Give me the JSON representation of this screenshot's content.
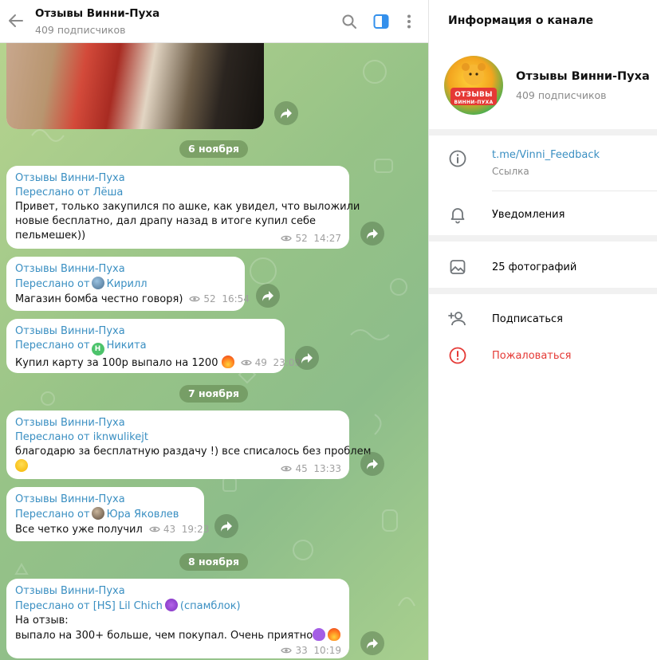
{
  "header": {
    "title": "Отзывы Винни-Пуха",
    "subscribers": "409 подписчиков"
  },
  "dates": [
    "6 ноября",
    "7 ноября",
    "8 ноября"
  ],
  "messages": [
    {
      "channel": "Отзывы Винни-Пуха",
      "fwd_prefix": "Переслано от",
      "fwd_name": "Лёша",
      "lines": [
        "Привет, только закупился по ашке, как увидел, что выложили",
        "новые бесплатно, дал драпу назад в итоге купил себе",
        "пельмешек))"
      ],
      "views": "52",
      "time": "14:27"
    },
    {
      "channel": "Отзывы Винни-Пуха",
      "fwd_prefix": "Переслано от",
      "fwd_name": "Кирилл",
      "lines": [
        "Магазин бомба честно говоря)"
      ],
      "views": "52",
      "time": "16:54"
    },
    {
      "channel": "Отзывы Винни-Пуха",
      "fwd_prefix": "Переслано от",
      "fwd_name": "Никита",
      "avatar_letter": "Н",
      "lines": [
        "Купил карту за 100р выпало на 1200"
      ],
      "views": "49",
      "time": "23:09"
    },
    {
      "channel": "Отзывы Винни-Пуха",
      "fwd_prefix": "Переслано от",
      "fwd_name": "iknwulikejt",
      "lines": [
        "благодарю за бесплатную раздачу !) все списалось без проблем"
      ],
      "views": "45",
      "time": "13:33"
    },
    {
      "channel": "Отзывы Винни-Пуха",
      "fwd_prefix": "Переслано от",
      "fwd_name": "Юра Яковлев",
      "lines": [
        "Все четко уже получил"
      ],
      "views": "43",
      "time": "19:23"
    },
    {
      "channel": "Отзывы Винни-Пуха",
      "fwd_prefix": "Переслано от",
      "fwd_name": "[HS] Lil Chich",
      "fwd_suffix": "(спамблок)",
      "lines": [
        "На отзыв:",
        " выпало на 300+ больше, чем покупал. Очень приятно"
      ],
      "views": "33",
      "time": "10:19"
    }
  ],
  "panel": {
    "title": "Информация о канале",
    "channel_name": "Отзывы Винни-Пуха",
    "subscribers": "409 подписчиков",
    "logo_text": "ОТЗЫВЫ",
    "logo_subtext": "ВИННИ-ПУХА",
    "link": "t.me/Vinni_Feedback",
    "link_label": "Ссылка",
    "notifications": "Уведомления",
    "photos": "25 фотографий",
    "subscribe": "Подписаться",
    "report": "Пожаловаться"
  },
  "icons": {
    "back": "arrow-left-icon",
    "search": "search-icon",
    "sidebar": "sidebar-toggle-icon",
    "menu": "more-vertical-icon",
    "forward": "forward-arrow-icon",
    "views": "eye-icon",
    "info": "info-icon",
    "bell": "bell-icon",
    "photo": "photo-icon",
    "add_user": "add-user-icon",
    "report": "warning-icon"
  },
  "colors": {
    "accent": "#3a8fc2",
    "header_icon_active": "#3390ec",
    "report": "#e53935",
    "date_pill": "#6f9a5a"
  }
}
